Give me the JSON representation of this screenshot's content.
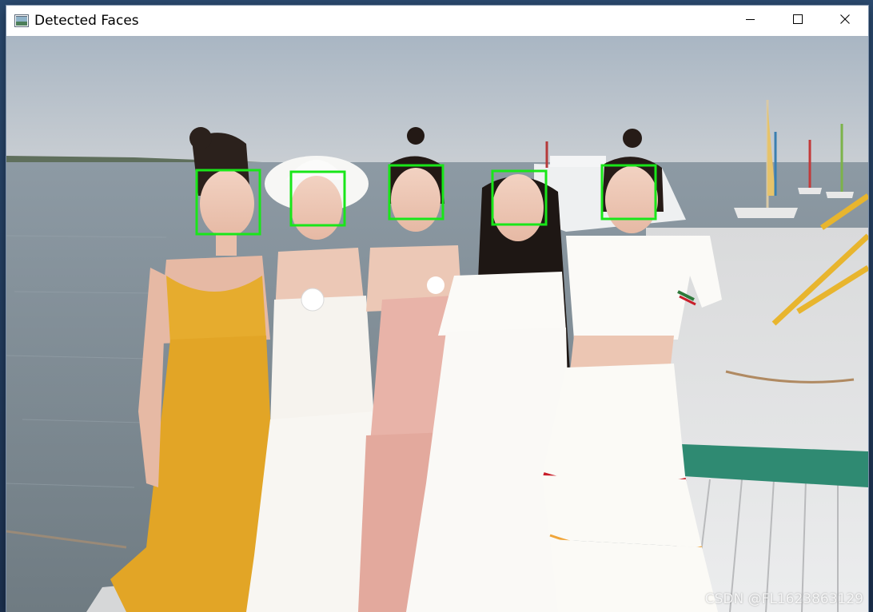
{
  "window": {
    "title": "Detected Faces",
    "icon": "opencv-window-icon"
  },
  "controls": {
    "minimize_icon": "minimize-icon",
    "maximize_icon": "maximize-icon",
    "close_icon": "close-icon"
  },
  "image": {
    "content": "photo of five women standing on a pier by the water",
    "detection_box_color": "#19e619",
    "detected_face_count": 5
  },
  "watermark": "CSDN @FL1623863129"
}
